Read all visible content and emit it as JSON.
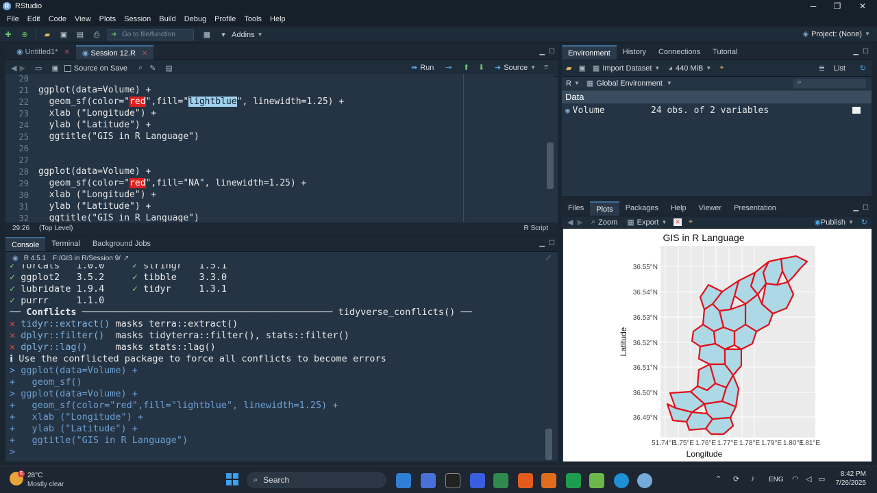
{
  "window": {
    "title": "RStudio",
    "app_letter": "R"
  },
  "menu": [
    "File",
    "Edit",
    "Code",
    "View",
    "Plots",
    "Session",
    "Build",
    "Debug",
    "Profile",
    "Tools",
    "Help"
  ],
  "toolbar": {
    "goto_placeholder": "Go to file/function",
    "addins_label": "Addins",
    "project_label": "Project: (None)"
  },
  "editor": {
    "tabs": [
      {
        "label": "Untitled1*"
      },
      {
        "label": "Session 12.R"
      }
    ],
    "source_on_save": "Source on Save",
    "run_label": "Run",
    "source_label": "Source",
    "lines": [
      {
        "n": "20",
        "text": ""
      },
      {
        "n": "21",
        "text": "ggplot(data=Volume) +"
      },
      {
        "n": "22",
        "pre": "  geom_sf(color=\"",
        "hl1": "red",
        "mid": "\",fill=\"",
        "hl2": "lightblue",
        "post": "\", linewidth=1.25) +"
      },
      {
        "n": "23",
        "text": "  xlab (\"Longitude\") +"
      },
      {
        "n": "24",
        "text": "  ylab (\"Latitude\") +"
      },
      {
        "n": "25",
        "text": "  ggtitle(\"GIS in R Language\")"
      },
      {
        "n": "26",
        "text": ""
      },
      {
        "n": "27",
        "text": ""
      },
      {
        "n": "28",
        "text": "ggplot(data=Volume) +"
      },
      {
        "n": "29",
        "pre": "  geom_sf(color=\"",
        "hl1": "red",
        "mid": "\",fill=\"NA\", linewidth=1.25) +",
        "hl2": "",
        "post": ""
      },
      {
        "n": "30",
        "text": "  xlab (\"Longitude\") +"
      },
      {
        "n": "31",
        "text": "  ylab (\"Latitude\") +"
      },
      {
        "n": "32",
        "text": "  ggtitle(\"GIS in R Language\")"
      }
    ],
    "status_pos": "29:26",
    "status_scope": "(Top Level)",
    "status_type": "R Script"
  },
  "console": {
    "tabs": [
      "Console",
      "Terminal",
      "Background Jobs"
    ],
    "r_version": "R 4.5.1",
    "path": "F:/GIS in R/Session 9/",
    "pkg_rows": [
      {
        "a": "forcats",
        "av": "1.0.0",
        "b": "stringr",
        "bv": "1.5.1"
      },
      {
        "a": "ggplot2",
        "av": "3.5.2",
        "b": "tibble",
        "bv": "3.3.0"
      },
      {
        "a": "lubridate",
        "av": "1.9.4",
        "b": "tidyr",
        "bv": "1.3.1"
      },
      {
        "a": "purrr",
        "av": "1.1.0",
        "b": "",
        "bv": ""
      }
    ],
    "conflicts_header": "Conflicts",
    "conflicts_tag": "tidyverse_conflicts()",
    "conflicts": [
      {
        "fn": "tidyr::extract()",
        "masks": "masks terra::extract()"
      },
      {
        "fn": "dplyr::filter()",
        "masks": "masks tidyterra::filter(), stats::filter()"
      },
      {
        "fn": "dplyr::lag()",
        "masks": "masks stats::lag()"
      }
    ],
    "info_line": "Use the conflicted package to force all conflicts to become errors",
    "history": [
      "> ggplot(data=Volume) +",
      "+   geom_sf()",
      "> ggplot(data=Volume) +",
      "+   geom_sf(color=\"red\",fill=\"lightblue\", linewidth=1.25) +",
      "+   xlab (\"Longitude\") +",
      "+   ylab (\"Latitude\") +",
      "+   ggtitle(\"GIS in R Language\")",
      ">"
    ]
  },
  "environment": {
    "tabs": [
      "Environment",
      "History",
      "Connections",
      "Tutorial"
    ],
    "import_label": "Import Dataset",
    "memory": "440 MiB",
    "list_label": "List",
    "lang": "R",
    "scope": "Global Environment",
    "section": "Data",
    "rows": [
      {
        "name": "Volume",
        "value": "24 obs. of 2 variables"
      }
    ]
  },
  "files": {
    "tabs": [
      "Files",
      "Plots",
      "Packages",
      "Help",
      "Viewer",
      "Presentation"
    ],
    "zoom_label": "Zoom",
    "export_label": "Export",
    "publish_label": "Publish"
  },
  "plot": {
    "title": "GIS in R Language",
    "xlabel": "Longitude",
    "ylabel": "Latitude",
    "xticks": [
      "51.74°E",
      "1.75°E",
      "1.76°E",
      "1.77°E",
      "1.78°E",
      "1.79°E",
      "1.80°E",
      "1.81°E"
    ],
    "yticks": [
      "36.55°N",
      "36.54°N",
      "36.53°N",
      "36.52°N",
      "36.51°N",
      "36.50°N",
      "36.49°N"
    ],
    "fill_color": "#add8e6",
    "stroke_color": "#e0101a",
    "panel_bg": "#ebebeb"
  },
  "taskbar": {
    "temp": "28°C",
    "weather": "Mostly clear",
    "badge": "5",
    "search": "Search",
    "lang": "ENG",
    "time": "8:42 PM",
    "date": "7/26/2025"
  }
}
